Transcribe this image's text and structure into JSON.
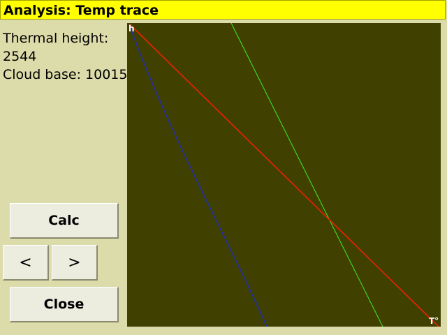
{
  "window": {
    "title": "Analysis: Temp trace"
  },
  "info": {
    "thermal_height_label": "Thermal height:",
    "thermal_height_value": "2544",
    "cloud_base_text": "Cloud base: 10015"
  },
  "buttons": {
    "calc": "Calc",
    "prev": "<",
    "next": ">",
    "close": "Close"
  },
  "plot": {
    "y_axis_label": "h",
    "x_axis_label": "T°",
    "colors": {
      "background": "#404000",
      "red_line": "#ee2200",
      "green_line": "#44ee22",
      "blue_line": "#1f2fa8"
    }
  }
}
